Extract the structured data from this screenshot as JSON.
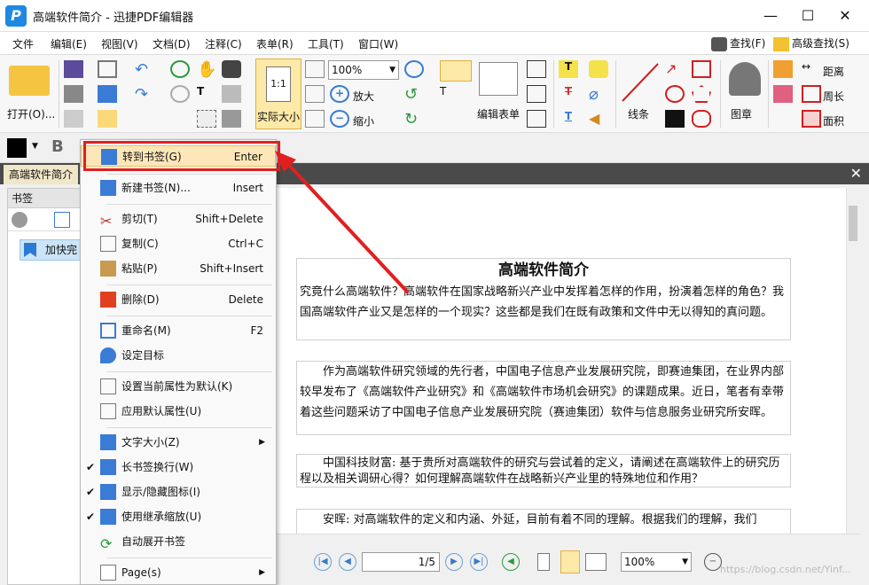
{
  "window": {
    "title": "高端软件简介 - 迅捷PDF编辑器",
    "minimize": "—",
    "maximize": "☐",
    "close": "✕"
  },
  "menu": [
    "文件",
    "编辑(E)",
    "视图(V)",
    "文档(D)",
    "注释(C)",
    "表单(R)",
    "工具(T)",
    "窗口(W)"
  ],
  "search": {
    "find": "查找(F)",
    "advanced": "高级查找(S)"
  },
  "toolbar": {
    "open": "打开(O)...",
    "actual_size_num": "1:1",
    "actual_size": "实际大小",
    "zoom": "100%",
    "zoom_in": "放大",
    "zoom_out": "缩小",
    "edit_form": "编辑表单",
    "line": "线条",
    "stamp": "图章",
    "distance": "距离",
    "perimeter": "周长",
    "area": "面积"
  },
  "tab": {
    "doc_name": "高端软件简介",
    "close": "✕"
  },
  "bookmarks": {
    "title": "书签",
    "item": "加快完"
  },
  "document": {
    "title": "高端软件简介",
    "p1": "究竟什么高端软件？高端软件在国家战略新兴产业中发挥着怎样的作用，扮演着怎样的角色？我国高端软件产业又是怎样的一个现实？这些都是我们在既有政策和文件中无以得知的真问题。",
    "p2": "作为高端软件研究领域的先行者，中国电子信息产业发展研究院，即赛迪集团，在业界内部较早发布了《高端软件产业研究》和《高端软件市场机会研究》的课题成果。近日，笔者有幸带着这些问题采访了中国电子信息产业发展研究院（赛迪集团）软件与信息服务业研究所安晖。",
    "p3": "中国科技财富: 基于贵所对高端软件的研究与尝试着的定义，请阐述在高端软件上的研究历程以及相关调研心得？如何理解高端软件在战略新兴产业里的特殊地位和作用？",
    "p4": "安晖: 对高端软件的定义和内涵、外延，目前有着不同的理解。根据我们的理解，我们"
  },
  "status": {
    "page": "1/5",
    "zoom": "100%"
  },
  "context_menu": [
    {
      "label": "转到书签(G)",
      "shortcut": "Enter"
    },
    {
      "label": "新建书签(N)...",
      "shortcut": "Insert"
    },
    {
      "label": "剪切(T)",
      "shortcut": "Shift+Delete"
    },
    {
      "label": "复制(C)",
      "shortcut": "Ctrl+C"
    },
    {
      "label": "粘贴(P)",
      "shortcut": "Shift+Insert"
    },
    {
      "label": "删除(D)",
      "shortcut": "Delete"
    },
    {
      "label": "重命名(M)",
      "shortcut": "F2"
    },
    {
      "label": "设定目标",
      "shortcut": ""
    },
    {
      "label": "设置当前属性为默认(K)",
      "shortcut": ""
    },
    {
      "label": "应用默认属性(U)",
      "shortcut": ""
    },
    {
      "label": "文字大小(Z)",
      "shortcut": ""
    },
    {
      "label": "长书签换行(W)",
      "shortcut": ""
    },
    {
      "label": "显示/隐藏图标(I)",
      "shortcut": ""
    },
    {
      "label": "使用继承缩放(U)",
      "shortcut": ""
    },
    {
      "label": "自动展开书签",
      "shortcut": ""
    },
    {
      "label": "Page(s)",
      "shortcut": ""
    }
  ],
  "watermark": "https://blog.csdn.net/Yinf..."
}
